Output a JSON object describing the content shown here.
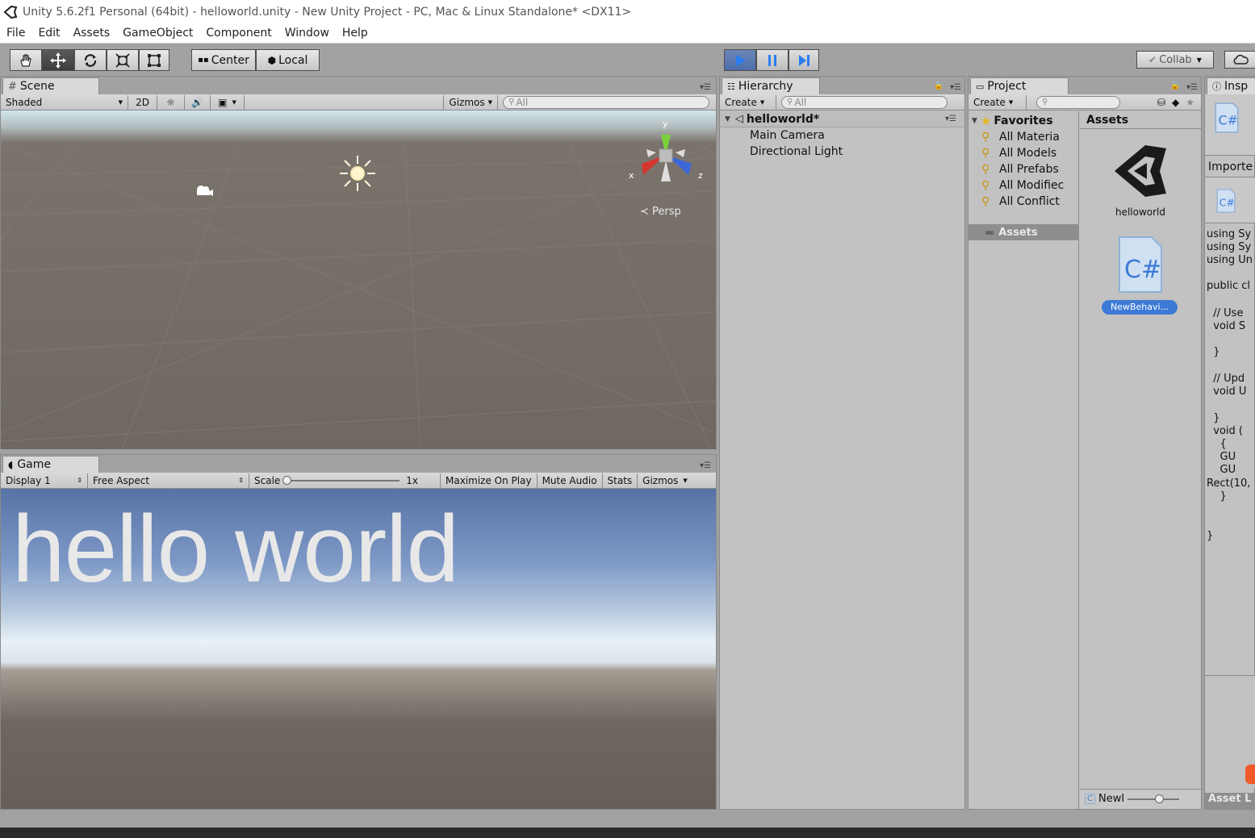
{
  "window": {
    "title": "Unity 5.6.2f1 Personal (64bit) - helloworld.unity - New Unity Project - PC, Mac & Linux Standalone* <DX11>"
  },
  "menu": [
    "File",
    "Edit",
    "Assets",
    "GameObject",
    "Component",
    "Window",
    "Help"
  ],
  "toolbar": {
    "pivot": "Center",
    "space": "Local",
    "collab": "Collab"
  },
  "scene": {
    "tab": "Scene",
    "shading": "Shaded",
    "mode_2d": "2D",
    "gizmos": "Gizmos",
    "search_placeholder": "All",
    "axis_x": "x",
    "axis_y": "y",
    "axis_z": "z",
    "projection": "Persp"
  },
  "game": {
    "tab": "Game",
    "display": "Display 1",
    "aspect": "Free Aspect",
    "scale_label": "Scale",
    "scale_value": "1x",
    "maximize": "Maximize On Play",
    "mute": "Mute Audio",
    "stats": "Stats",
    "gizmos": "Gizmos",
    "text": "hello world"
  },
  "hierarchy": {
    "tab": "Hierarchy",
    "create": "Create",
    "search_placeholder": "All",
    "scene_name": "helloworld*",
    "items": [
      "Main Camera",
      "Directional Light"
    ]
  },
  "project": {
    "tab": "Project",
    "create": "Create",
    "favorites": "Favorites",
    "favorite_items": [
      "All Materia",
      "All Models",
      "All Prefabs",
      "All Modifiec",
      "All Conflict"
    ],
    "assets_folder": "Assets",
    "assets_header": "Assets",
    "assets": [
      {
        "name": "helloworld",
        "icon": "unity-scene-icon"
      },
      {
        "name": "NewBehavi...",
        "icon": "csharp-script-icon"
      }
    ],
    "footer_label": "NewI"
  },
  "inspector": {
    "tab": "Insp",
    "section": "Importe",
    "code_lines": [
      "using Sy",
      "using Sy",
      "using Un",
      "",
      "public cl",
      "",
      "  // Use",
      "  void S",
      "",
      "  }",
      "",
      "  // Upd",
      "  void U",
      "",
      "  }",
      "  void (",
      "    {",
      "    GU",
      "    GU",
      "Rect(10,",
      "    }",
      "",
      "",
      "}"
    ],
    "footer": "Asset L"
  },
  "colors": {
    "accent_blue": "#3d7ad6",
    "play_bg": "#4f6ea8",
    "panel_bg": "#c2c2c2",
    "selection": "#3d7ad6"
  }
}
